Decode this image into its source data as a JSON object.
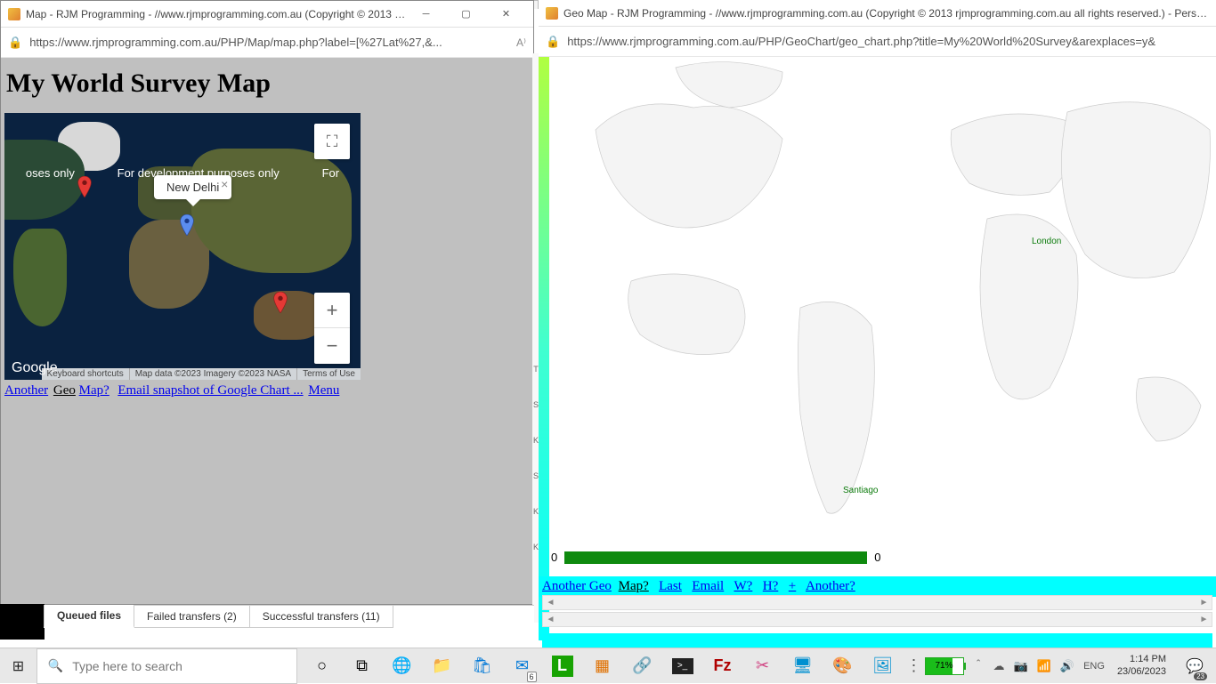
{
  "left_window": {
    "title": "Map - RJM Programming - //www.rjmprogramming.com.au (Copyright © 2013 rj...",
    "url": "https://www.rjmprogramming.com.au/PHP/Map/map.php?label=[%27Lat%27,&...",
    "page_title": "My World Survey Map",
    "dev_text_left": "oses only",
    "dev_text_center": "For development purposes only",
    "dev_text_right": "For",
    "infowindow": "New Delhi",
    "google_logo": "Google",
    "footer_shortcuts": "Keyboard shortcuts",
    "footer_data": "Map data ©2023 Imagery ©2023 NASA",
    "footer_terms": "Terms of Use",
    "links": {
      "another": "Another",
      "geo": "Geo",
      "map": "Map?",
      "email": "Email snapshot of Google Chart ...",
      "menu": "Menu"
    }
  },
  "right_window": {
    "title": "Geo Map - RJM Programming - //www.rjmprogramming.com.au (Copyright © 2013 rjmprogramming.com.au all rights reserved.) - Personal",
    "url": "https://www.rjmprogramming.com.au/PHP/GeoChart/geo_chart.php?title=My%20World%20Survey&arexplaces=y&",
    "label_london": "London",
    "label_santiago": "Santiago",
    "legend_min": "0",
    "legend_max": "0",
    "links": {
      "another_geo": "Another Geo",
      "map": "Map?",
      "last": "Last",
      "email": "Email",
      "w": "W?",
      "h": "H?",
      "plus": "+",
      "another": "Another?"
    }
  },
  "filezilla": {
    "queued": "Queued files",
    "failed": "Failed transfers (2)",
    "success": "Successful transfers (11)"
  },
  "taskbar": {
    "search_placeholder": "Type here to search",
    "mail_badge": "6",
    "battery": "71%",
    "lang": "ENG",
    "time": "1:14 PM",
    "date": "23/06/2023",
    "notif_count": "23"
  }
}
